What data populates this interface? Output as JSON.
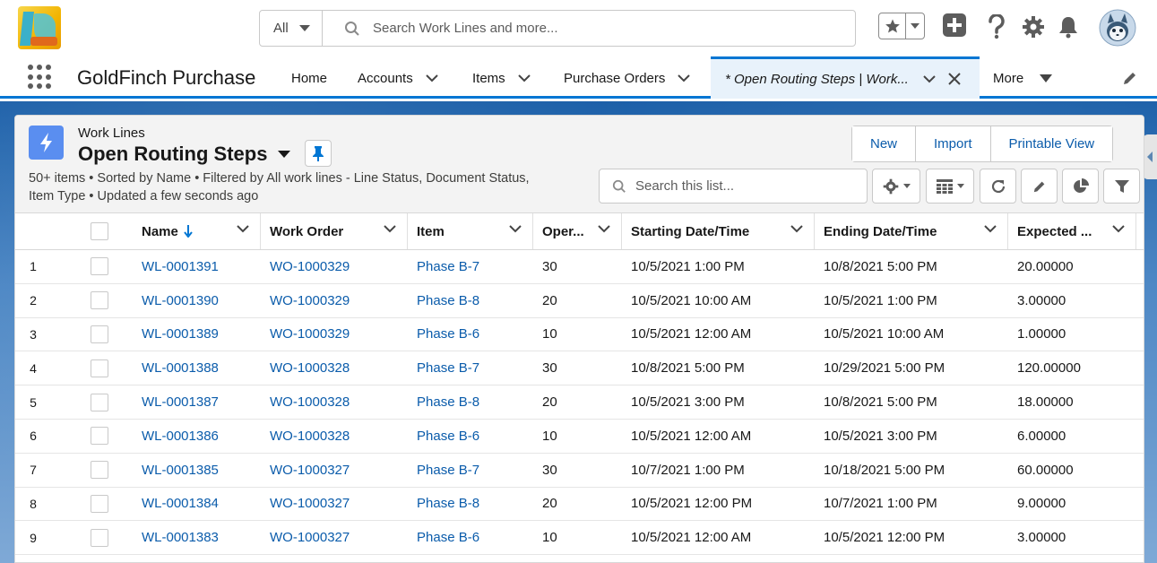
{
  "search": {
    "scope": "All",
    "placeholder": "Search Work Lines and more..."
  },
  "nav": {
    "app_name": "GoldFinch Purchase",
    "items": [
      {
        "label": "Home"
      },
      {
        "label": "Accounts"
      },
      {
        "label": "Items"
      },
      {
        "label": "Purchase Orders"
      },
      {
        "label": "* Open Routing Steps | Work..."
      },
      {
        "label": "More"
      }
    ]
  },
  "list": {
    "object_label": "Work Lines",
    "title": "Open Routing Steps",
    "info_line1": "50+ items • Sorted by Name • Filtered by All work lines - Line Status, Document Status,",
    "info_line2": "Item Type • Updated a few seconds ago",
    "buttons": {
      "new": "New",
      "import": "Import",
      "printable": "Printable View"
    },
    "search_placeholder": "Search this list..."
  },
  "table": {
    "columns": [
      "Name",
      "Work Order",
      "Item",
      "Oper...",
      "Starting Date/Time",
      "Ending Date/Time",
      "Expected ..."
    ],
    "rows": [
      {
        "num": "1",
        "name": "WL-0001391",
        "work_order": "WO-1000329",
        "item": "Phase B-7",
        "oper": "30",
        "start": "10/5/2021 1:00 PM",
        "end": "10/8/2021 5:00 PM",
        "expected": "20.00000"
      },
      {
        "num": "2",
        "name": "WL-0001390",
        "work_order": "WO-1000329",
        "item": "Phase B-8",
        "oper": "20",
        "start": "10/5/2021 10:00 AM",
        "end": "10/5/2021 1:00 PM",
        "expected": "3.00000"
      },
      {
        "num": "3",
        "name": "WL-0001389",
        "work_order": "WO-1000329",
        "item": "Phase B-6",
        "oper": "10",
        "start": "10/5/2021 12:00 AM",
        "end": "10/5/2021 10:00 AM",
        "expected": "1.00000"
      },
      {
        "num": "4",
        "name": "WL-0001388",
        "work_order": "WO-1000328",
        "item": "Phase B-7",
        "oper": "30",
        "start": "10/8/2021 5:00 PM",
        "end": "10/29/2021 5:00 PM",
        "expected": "120.00000"
      },
      {
        "num": "5",
        "name": "WL-0001387",
        "work_order": "WO-1000328",
        "item": "Phase B-8",
        "oper": "20",
        "start": "10/5/2021 3:00 PM",
        "end": "10/8/2021 5:00 PM",
        "expected": "18.00000"
      },
      {
        "num": "6",
        "name": "WL-0001386",
        "work_order": "WO-1000328",
        "item": "Phase B-6",
        "oper": "10",
        "start": "10/5/2021 12:00 AM",
        "end": "10/5/2021 3:00 PM",
        "expected": "6.00000"
      },
      {
        "num": "7",
        "name": "WL-0001385",
        "work_order": "WO-1000327",
        "item": "Phase B-7",
        "oper": "30",
        "start": "10/7/2021 1:00 PM",
        "end": "10/18/2021 5:00 PM",
        "expected": "60.00000"
      },
      {
        "num": "8",
        "name": "WL-0001384",
        "work_order": "WO-1000327",
        "item": "Phase B-8",
        "oper": "20",
        "start": "10/5/2021 12:00 PM",
        "end": "10/7/2021 1:00 PM",
        "expected": "9.00000"
      },
      {
        "num": "9",
        "name": "WL-0001383",
        "work_order": "WO-1000327",
        "item": "Phase B-6",
        "oper": "10",
        "start": "10/5/2021 12:00 AM",
        "end": "10/5/2021 12:00 PM",
        "expected": "3.00000"
      }
    ]
  },
  "colors": {
    "link": "#0b5cab",
    "brand": "#0176d3",
    "object_icon": "#5a8ef0"
  }
}
